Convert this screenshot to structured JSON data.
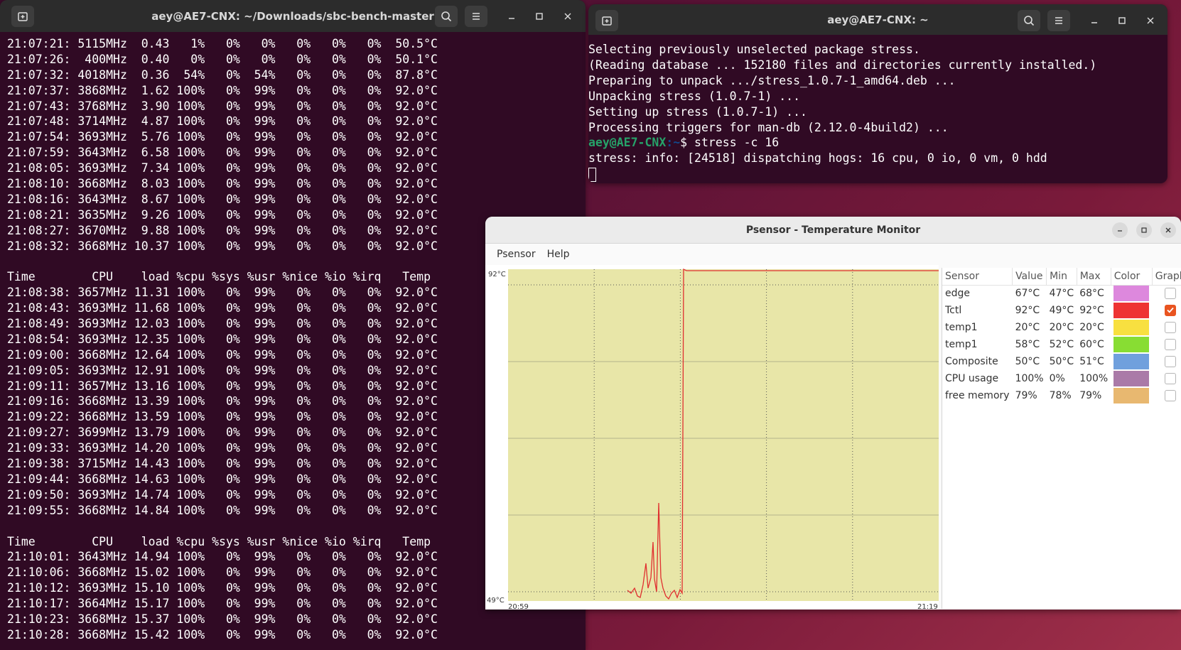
{
  "left_terminal": {
    "title": "aey@AE7-CNX: ~/Downloads/sbc-bench-master",
    "lines": [
      "21:07:21: 5115MHz  0.43   1%   0%   0%   0%   0%   0%  50.5°C",
      "21:07:26:  400MHz  0.40   0%   0%   0%   0%   0%   0%  50.1°C",
      "21:07:32: 4018MHz  0.36  54%   0%  54%   0%   0%   0%  87.8°C",
      "21:07:37: 3868MHz  1.62 100%   0%  99%   0%   0%   0%  92.0°C",
      "21:07:43: 3768MHz  3.90 100%   0%  99%   0%   0%   0%  92.0°C",
      "21:07:48: 3714MHz  4.87 100%   0%  99%   0%   0%   0%  92.0°C",
      "21:07:54: 3693MHz  5.76 100%   0%  99%   0%   0%   0%  92.0°C",
      "21:07:59: 3643MHz  6.58 100%   0%  99%   0%   0%   0%  92.0°C",
      "21:08:05: 3693MHz  7.34 100%   0%  99%   0%   0%   0%  92.0°C",
      "21:08:10: 3668MHz  8.03 100%   0%  99%   0%   0%   0%  92.0°C",
      "21:08:16: 3643MHz  8.67 100%   0%  99%   0%   0%   0%  92.0°C",
      "21:08:21: 3635MHz  9.26 100%   0%  99%   0%   0%   0%  92.0°C",
      "21:08:27: 3670MHz  9.88 100%   0%  99%   0%   0%   0%  92.0°C",
      "21:08:32: 3668MHz 10.37 100%   0%  99%   0%   0%   0%  92.0°C",
      "",
      "Time        CPU    load %cpu %sys %usr %nice %io %irq   Temp",
      "21:08:38: 3657MHz 11.31 100%   0%  99%   0%   0%   0%  92.0°C",
      "21:08:43: 3693MHz 11.68 100%   0%  99%   0%   0%   0%  92.0°C",
      "21:08:49: 3693MHz 12.03 100%   0%  99%   0%   0%   0%  92.0°C",
      "21:08:54: 3693MHz 12.35 100%   0%  99%   0%   0%   0%  92.0°C",
      "21:09:00: 3668MHz 12.64 100%   0%  99%   0%   0%   0%  92.0°C",
      "21:09:05: 3693MHz 12.91 100%   0%  99%   0%   0%   0%  92.0°C",
      "21:09:11: 3657MHz 13.16 100%   0%  99%   0%   0%   0%  92.0°C",
      "21:09:16: 3668MHz 13.39 100%   0%  99%   0%   0%   0%  92.0°C",
      "21:09:22: 3668MHz 13.59 100%   0%  99%   0%   0%   0%  92.0°C",
      "21:09:27: 3699MHz 13.79 100%   0%  99%   0%   0%   0%  92.0°C",
      "21:09:33: 3693MHz 14.20 100%   0%  99%   0%   0%   0%  92.0°C",
      "21:09:38: 3715MHz 14.43 100%   0%  99%   0%   0%   0%  92.0°C",
      "21:09:44: 3668MHz 14.63 100%   0%  99%   0%   0%   0%  92.0°C",
      "21:09:50: 3693MHz 14.74 100%   0%  99%   0%   0%   0%  92.0°C",
      "21:09:55: 3668MHz 14.84 100%   0%  99%   0%   0%   0%  92.0°C",
      "",
      "Time        CPU    load %cpu %sys %usr %nice %io %irq   Temp",
      "21:10:01: 3643MHz 14.94 100%   0%  99%   0%   0%   0%  92.0°C",
      "21:10:06: 3668MHz 15.02 100%   0%  99%   0%   0%   0%  92.0°C",
      "21:10:12: 3693MHz 15.10 100%   0%  99%   0%   0%   0%  92.0°C",
      "21:10:17: 3664MHz 15.17 100%   0%  99%   0%   0%   0%  92.0°C",
      "21:10:23: 3668MHz 15.37 100%   0%  99%   0%   0%   0%  92.0°C",
      "21:10:28: 3668MHz 15.42 100%   0%  99%   0%   0%   0%  92.0°C"
    ]
  },
  "right_terminal": {
    "title": "aey@AE7-CNX: ~",
    "lines": [
      "Selecting previously unselected package stress.",
      "(Reading database ... 152180 files and directories currently installed.)",
      "Preparing to unpack .../stress_1.0.7-1_amd64.deb ...",
      "Unpacking stress (1.0.7-1) ...",
      "Setting up stress (1.0.7-1) ...",
      "Processing triggers for man-db (2.12.0-4build2) ..."
    ],
    "prompt_user": "aey@AE7-CNX",
    "prompt_path": ":~",
    "prompt_symbol": "$ ",
    "command": "stress -c 16",
    "output": "stress: info: [24518] dispatching hogs: 16 cpu, 0 io, 0 vm, 0 hdd"
  },
  "psensor": {
    "title": "Psensor - Temperature Monitor",
    "menu": [
      "Psensor",
      "Help"
    ],
    "graph": {
      "y_max_label": "92°C",
      "y_min_label": "49°C",
      "x_start_label": "20:59",
      "x_end_label": "21:19",
      "background": "#e8e6a8",
      "line_color": "#e03030"
    },
    "columns": [
      "Sensor",
      "Value",
      "Min",
      "Max",
      "Color",
      "Graph"
    ],
    "sensors": [
      {
        "name": "edge",
        "value": "67°C",
        "min": "47°C",
        "max": "68°C",
        "color": "#dd88dd",
        "graph": false
      },
      {
        "name": "Tctl",
        "value": "92°C",
        "min": "49°C",
        "max": "92°C",
        "color": "#ee3333",
        "graph": true
      },
      {
        "name": "temp1",
        "value": "20°C",
        "min": "20°C",
        "max": "20°C",
        "color": "#f8e040",
        "graph": false
      },
      {
        "name": "temp1",
        "value": "58°C",
        "min": "52°C",
        "max": "60°C",
        "color": "#88dd33",
        "graph": false
      },
      {
        "name": "Composite",
        "value": "50°C",
        "min": "50°C",
        "max": "51°C",
        "color": "#70a0dd",
        "graph": false
      },
      {
        "name": "CPU usage",
        "value": "100%",
        "min": "0%",
        "max": "100%",
        "color": "#aa7aa8",
        "graph": false
      },
      {
        "name": "free memory",
        "value": "79%",
        "min": "78%",
        "max": "79%",
        "color": "#e8b870",
        "graph": false
      }
    ]
  }
}
